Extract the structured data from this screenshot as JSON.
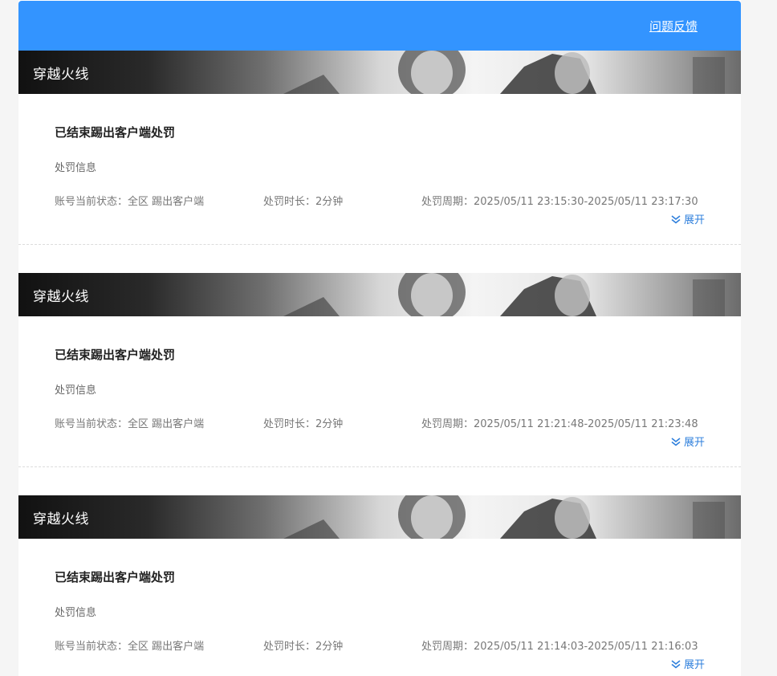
{
  "header": {
    "feedback_label": "问题反馈"
  },
  "records": [
    {
      "game": "穿越火线",
      "status_title": "已结束踢出客户端处罚",
      "info_label": "处罚信息",
      "account_state_label": "账号当前状态：",
      "account_state_value": "全区 踢出客户端",
      "duration_label": "处罚时长：",
      "duration_value": "2分钟",
      "period_label": "处罚周期：",
      "period_value": "2025/05/11 23:15:30-2025/05/11 23:17:30",
      "expand_label": "展开"
    },
    {
      "game": "穿越火线",
      "status_title": "已结束踢出客户端处罚",
      "info_label": "处罚信息",
      "account_state_label": "账号当前状态：",
      "account_state_value": "全区 踢出客户端",
      "duration_label": "处罚时长：",
      "duration_value": "2分钟",
      "period_label": "处罚周期：",
      "period_value": "2025/05/11 21:21:48-2025/05/11 21:23:48",
      "expand_label": "展开"
    },
    {
      "game": "穿越火线",
      "status_title": "已结束踢出客户端处罚",
      "info_label": "处罚信息",
      "account_state_label": "账号当前状态：",
      "account_state_value": "全区 踢出客户端",
      "duration_label": "处罚时长：",
      "duration_value": "2分钟",
      "period_label": "处罚周期：",
      "period_value": "2025/05/11 21:14:03-2025/05/11 21:16:03",
      "expand_label": "展开"
    }
  ],
  "colors": {
    "header_bg": "#3394ff",
    "link": "#2e7fdc"
  },
  "icons": [
    "chevron-double-down-icon"
  ]
}
